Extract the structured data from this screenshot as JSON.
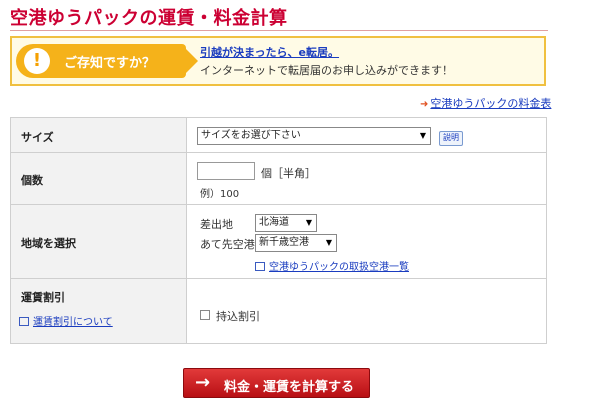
{
  "page": {
    "title": "空港ゆうパックの運賃・料金計算"
  },
  "notice": {
    "badge": "ご存知ですか？",
    "icon_glyph": "!",
    "link": "引越が決まったら、e転居。",
    "text": "インターネットで転居届のお申し込みができます！"
  },
  "fee_table_link": {
    "arrow": "➜",
    "label": "空港ゆうパックの料金表"
  },
  "form": {
    "size": {
      "label": "サイズ",
      "selected": "サイズをお選び下さい",
      "help_button": "説明"
    },
    "count": {
      "label": "個数",
      "value": "",
      "unit": "個［半角］",
      "example": "例）100"
    },
    "region": {
      "label": "地域を選択",
      "origin_label": "差出地",
      "origin_value": "北海道",
      "dest_label": "あて先空港",
      "dest_value": "新千歳空港",
      "airports_link": "空港ゆうパックの取扱空港一覧"
    },
    "discount": {
      "label": "運賃割引",
      "about_link": "運賃割引について",
      "checkbox_label": "持込割引",
      "checked": false
    }
  },
  "calc_button": {
    "arrow": "→",
    "label": "料金・運賃を計算する"
  },
  "colors": {
    "title": "#cc0033",
    "accent": "#f5b21a",
    "link": "#1a3cbf",
    "button": "#c81e23"
  }
}
